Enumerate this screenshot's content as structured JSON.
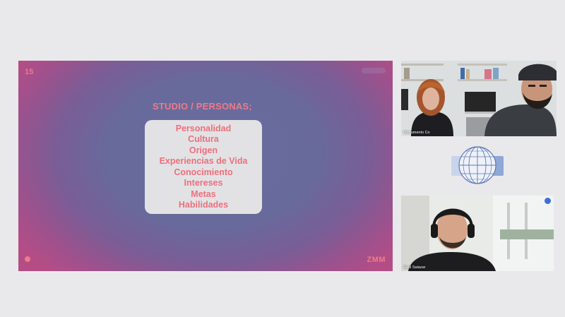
{
  "slide": {
    "number": "15",
    "title": "STUDIO / PERSONAS;",
    "items": [
      "Personalidad",
      "Cultura",
      "Origen",
      "Experiencias de Vida",
      "Conocimiento",
      "Intereses",
      "Metas",
      "Habilidades"
    ],
    "brand": "ZMM"
  },
  "participants": [
    {
      "name": "Monumento Co"
    },
    {
      "name": "Raúl Salazar"
    }
  ],
  "icons": {
    "slide_dot": "circle-icon",
    "pin": "pin-icon",
    "logo": "globe-logo-icon"
  },
  "colors": {
    "accent": "#f07a86",
    "card": "#e2e2e4",
    "background": "#e9e9eb"
  }
}
